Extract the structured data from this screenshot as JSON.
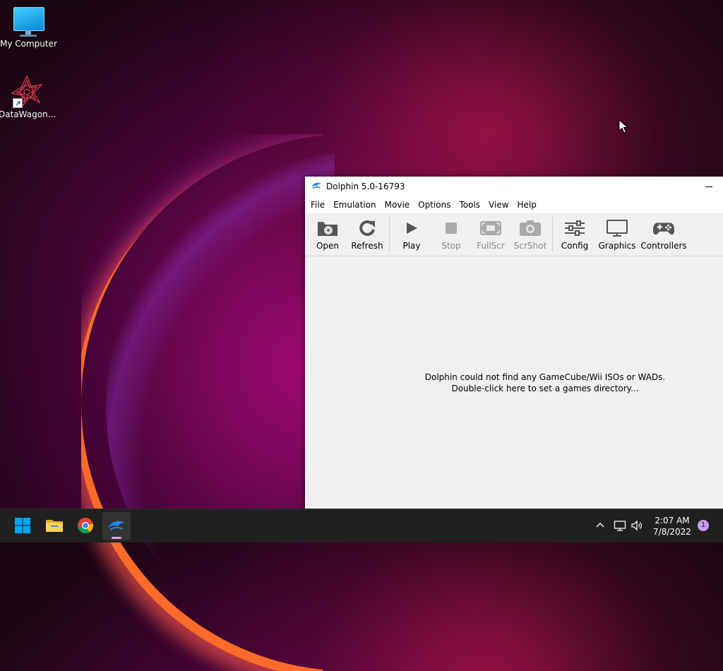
{
  "desktop": {
    "icons": [
      {
        "label": "My Computer"
      },
      {
        "label": "DataWagon..."
      }
    ]
  },
  "window": {
    "title": "Dolphin 5.0-16793",
    "menu": [
      "File",
      "Emulation",
      "Movie",
      "Options",
      "Tools",
      "View",
      "Help"
    ],
    "toolbar": {
      "open": "Open",
      "refresh": "Refresh",
      "play": "Play",
      "stop": "Stop",
      "fullscr": "FullScr",
      "scrshot": "ScrShot",
      "config": "Config",
      "graphics": "Graphics",
      "controllers": "Controllers"
    },
    "empty_message": {
      "line1": "Dolphin could not find any GameCube/Wii ISOs or WADs.",
      "line2": "Double-click here to set a games directory..."
    }
  },
  "taskbar": {
    "apps": [
      "start-icon",
      "file-explorer-icon",
      "chrome-icon",
      "dolphin-icon"
    ],
    "clock": {
      "time": "2:07 AM",
      "date": "7/8/2022"
    },
    "notification_count": "1"
  },
  "colors": {
    "taskbar_bg": "#202020",
    "window_bg": "#f0f0f0",
    "dolphin_blue": "#1e88e5",
    "windows_blue": "#00a4ef"
  }
}
